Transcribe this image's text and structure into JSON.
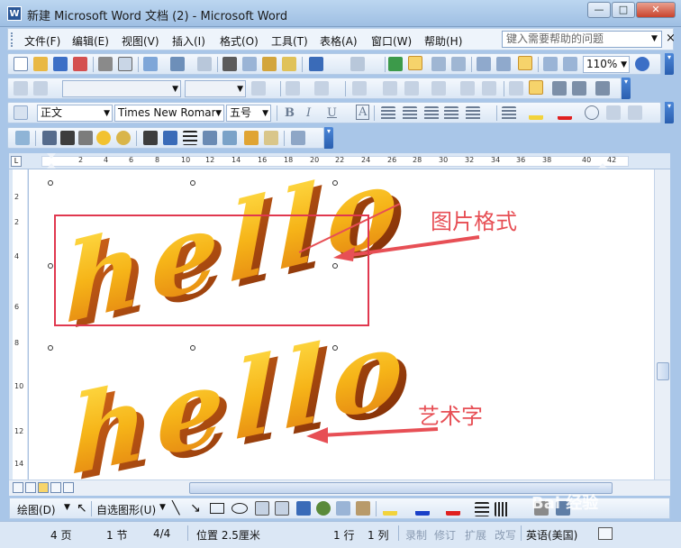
{
  "window": {
    "title": "新建 Microsoft Word 文档 (2) - Microsoft Word",
    "app_icon": "W"
  },
  "window_controls": {
    "minimize": "—",
    "maximize": "□",
    "close": "✕"
  },
  "menu": {
    "items": [
      "文件(F)",
      "编辑(E)",
      "视图(V)",
      "插入(I)",
      "格式(O)",
      "工具(T)",
      "表格(A)",
      "窗口(W)",
      "帮助(H)"
    ],
    "help_placeholder": "键入需要帮助的问题",
    "close_glyph": "×"
  },
  "standard_toolbar": {
    "zoom": "110%"
  },
  "formatting_toolbar": {
    "style": "正文",
    "font": "Times New Roman",
    "size": "五号",
    "bold": "B",
    "italic": "I",
    "underline": "U",
    "char_border": "A"
  },
  "ruler": {
    "marks": [
      "2",
      "4",
      "6",
      "8",
      "10",
      "12",
      "14",
      "16",
      "18",
      "20",
      "22",
      "24",
      "26",
      "28",
      "30",
      "32",
      "34",
      "36",
      "38",
      "40",
      "42"
    ]
  },
  "left_ruler": {
    "marks": [
      "2",
      "2",
      "4",
      "6",
      "8",
      "10",
      "12",
      "14"
    ]
  },
  "document": {
    "wordart_picture_text": "hello",
    "wordart_text": "hello",
    "annotation_picture": "图片格式",
    "annotation_wordart": "艺术字"
  },
  "drawing_toolbar": {
    "draw": "绘图(D)",
    "autoshapes": "自选图形(U)"
  },
  "status": {
    "page": "4 页",
    "section": "1 节",
    "page_of": "4/4",
    "position": "位置 2.5厘米",
    "line": "1 行",
    "column": "1 列",
    "rec": "录制",
    "trk": "修订",
    "ext": "扩展",
    "ovr": "改写",
    "language": "英语(美国)"
  },
  "watermark": "Bai 经验",
  "colors": {
    "annotation": "#e74f55",
    "wordart_front": "#f6c21a",
    "wordart_side": "#b5490e",
    "frame": "#e0384f"
  }
}
